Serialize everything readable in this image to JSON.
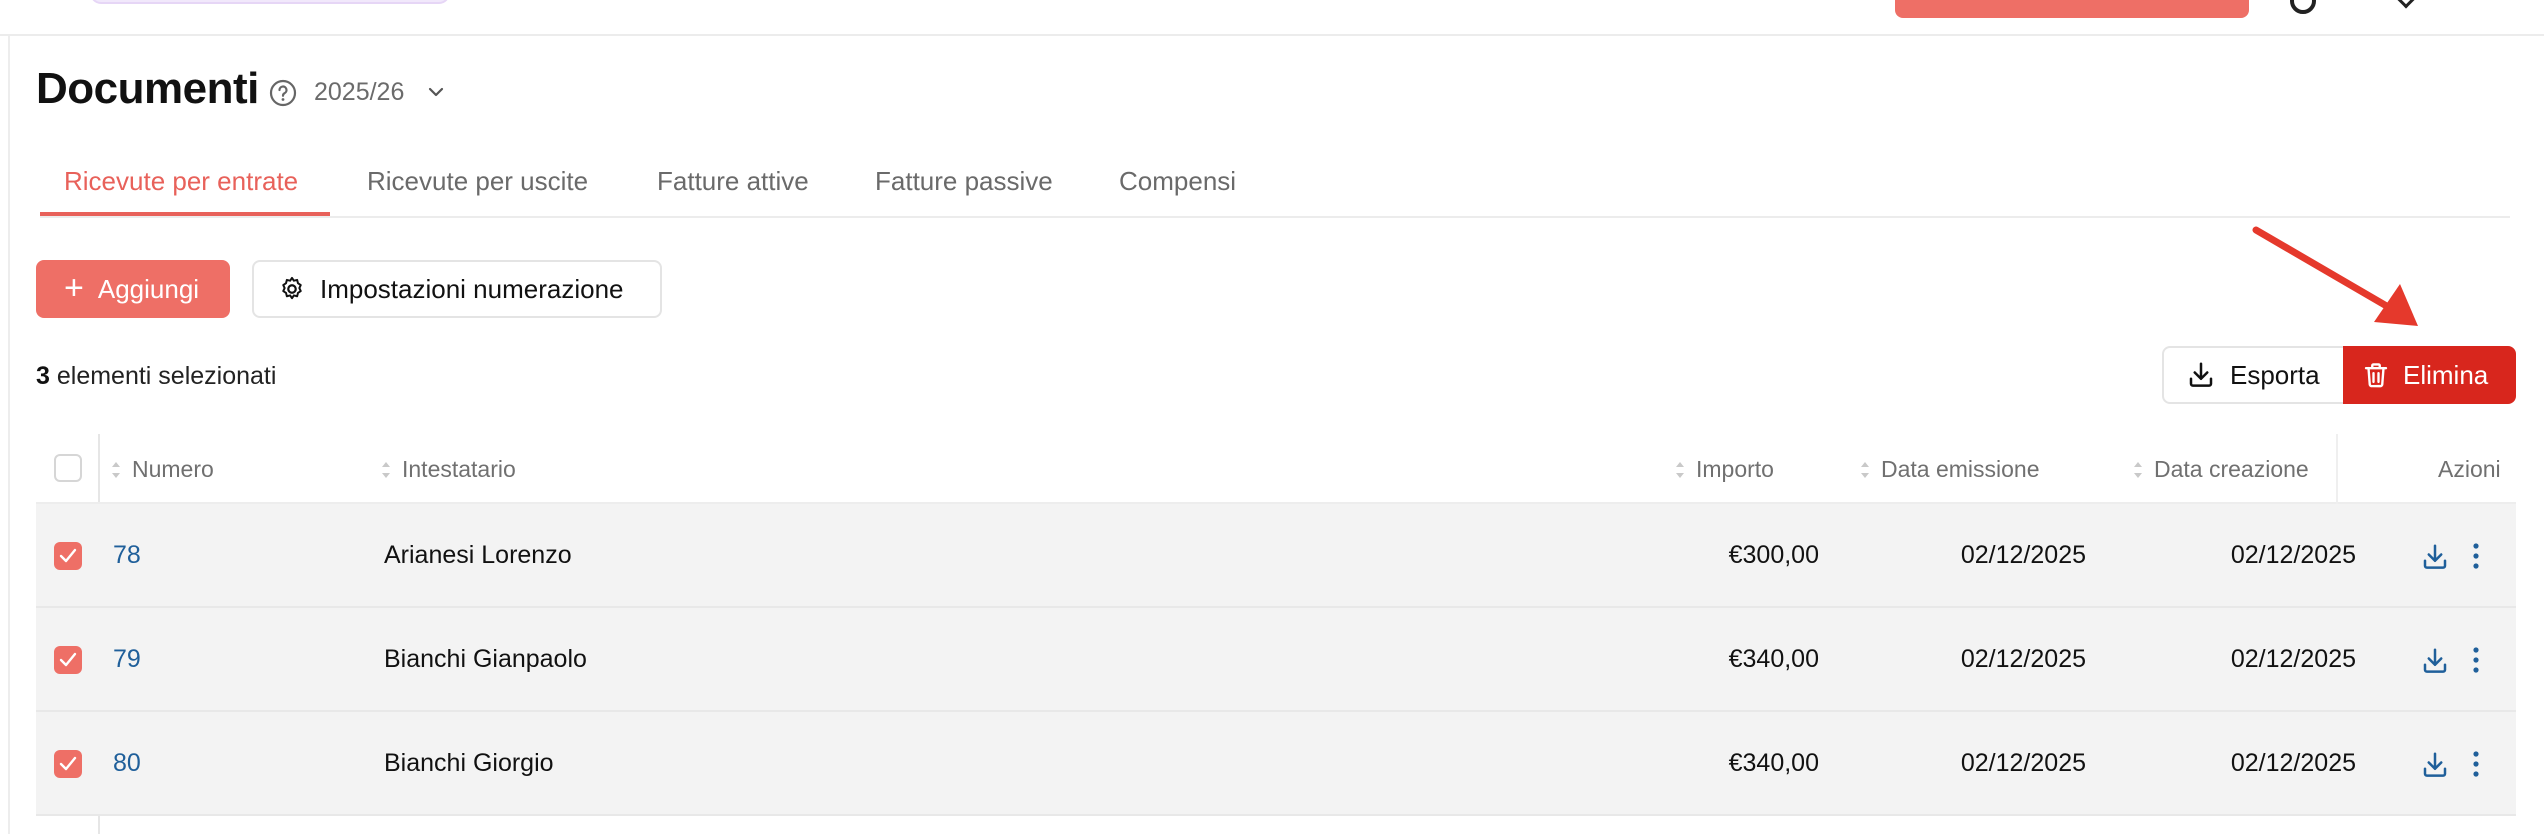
{
  "header": {
    "title": "Documenti",
    "year": "2025/26"
  },
  "tabs": [
    {
      "label": "Ricevute per entrate",
      "active": true
    },
    {
      "label": "Ricevute per uscite",
      "active": false
    },
    {
      "label": "Fatture attive",
      "active": false
    },
    {
      "label": "Fatture passive",
      "active": false
    },
    {
      "label": "Compensi",
      "active": false
    }
  ],
  "toolbar": {
    "add_label": "Aggiungi",
    "numbering_label": "Impostazioni numerazione"
  },
  "selection": {
    "count": "3",
    "text": "elementi selezionati",
    "export_label": "Esporta",
    "delete_label": "Elimina"
  },
  "table": {
    "columns": [
      "Numero",
      "Intestatario",
      "Importo",
      "Data emissione",
      "Data creazione",
      "Azioni"
    ],
    "rows": [
      {
        "numero": "78",
        "intestatario": "Arianesi Lorenzo",
        "importo": "€300,00",
        "emissione": "02/12/2025",
        "creazione": "02/12/2025",
        "selected": true
      },
      {
        "numero": "79",
        "intestatario": "Bianchi Gianpaolo",
        "importo": "€340,00",
        "emissione": "02/12/2025",
        "creazione": "02/12/2025",
        "selected": true
      },
      {
        "numero": "80",
        "intestatario": "Bianchi Giorgio",
        "importo": "€340,00",
        "emissione": "02/12/2025",
        "creazione": "02/12/2025",
        "selected": true
      }
    ]
  },
  "colors": {
    "accent": "#e8615a",
    "danger": "#d8261d",
    "link": "#1f5f9a",
    "annotation_arrow": "#e5392c"
  }
}
